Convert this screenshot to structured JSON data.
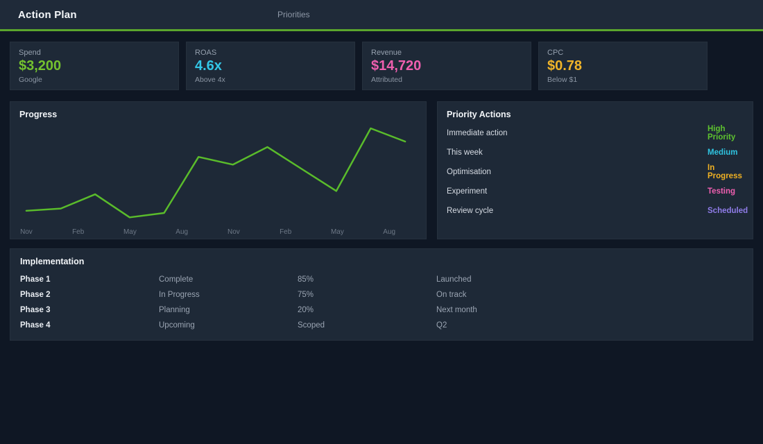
{
  "header": {
    "title": "Action Plan",
    "nav_label": "Priorities"
  },
  "colors": {
    "accent_green": "#5ba52d",
    "page_background": "#0f1724",
    "panel_background": "#1e2937"
  },
  "cards": [
    {
      "label": "Spend",
      "value": "$3,200",
      "sub": "Google",
      "color": "#74c22f"
    },
    {
      "label": "ROAS",
      "value": "4.6x",
      "sub": "Above 4x",
      "color": "#33c6e6"
    },
    {
      "label": "Revenue",
      "value": "$14,720",
      "sub": "Attributed",
      "color": "#ee5fae"
    },
    {
      "label": "CPC",
      "value": "$0.78",
      "sub": "Below $1",
      "color": "#f0b429"
    }
  ],
  "chart_data": {
    "type": "line",
    "title": "Progress",
    "x_tick_labels": [
      "Nov",
      "Feb",
      "May",
      "Aug",
      "Nov",
      "Feb",
      "May",
      "Aug"
    ],
    "values": [
      16,
      18,
      31,
      10,
      14,
      65,
      58,
      74,
      54,
      34,
      91,
      79
    ],
    "ylim": [
      0,
      100
    ],
    "xlabel": "",
    "ylabel": "",
    "grid": false,
    "legend_position": "none",
    "line_color": "#5abc2b",
    "tick_color": "#6e7987"
  },
  "priority": {
    "title": "Priority Actions",
    "rows": [
      {
        "label": "Immediate action",
        "value": "High Priority",
        "color": "#5ec22f"
      },
      {
        "label": "This week",
        "value": "Medium",
        "color": "#2fc3e0"
      },
      {
        "label": "Optimisation",
        "value": "In Progress",
        "color": "#f0b123"
      },
      {
        "label": "Experiment",
        "value": "Testing",
        "color": "#ef5fb0"
      },
      {
        "label": "Review cycle",
        "value": "Scheduled",
        "color": "#8f7ce8"
      }
    ]
  },
  "implementation": {
    "title": "Implementation",
    "rows": [
      {
        "phase": "Phase 1",
        "status": "Complete",
        "metric": "85%",
        "note": "Launched"
      },
      {
        "phase": "Phase 2",
        "status": "In Progress",
        "metric": "75%",
        "note": "On track"
      },
      {
        "phase": "Phase 3",
        "status": "Planning",
        "metric": "20%",
        "note": "Next month"
      },
      {
        "phase": "Phase 4",
        "status": "Upcoming",
        "metric": "Scoped",
        "note": "Q2"
      }
    ]
  }
}
